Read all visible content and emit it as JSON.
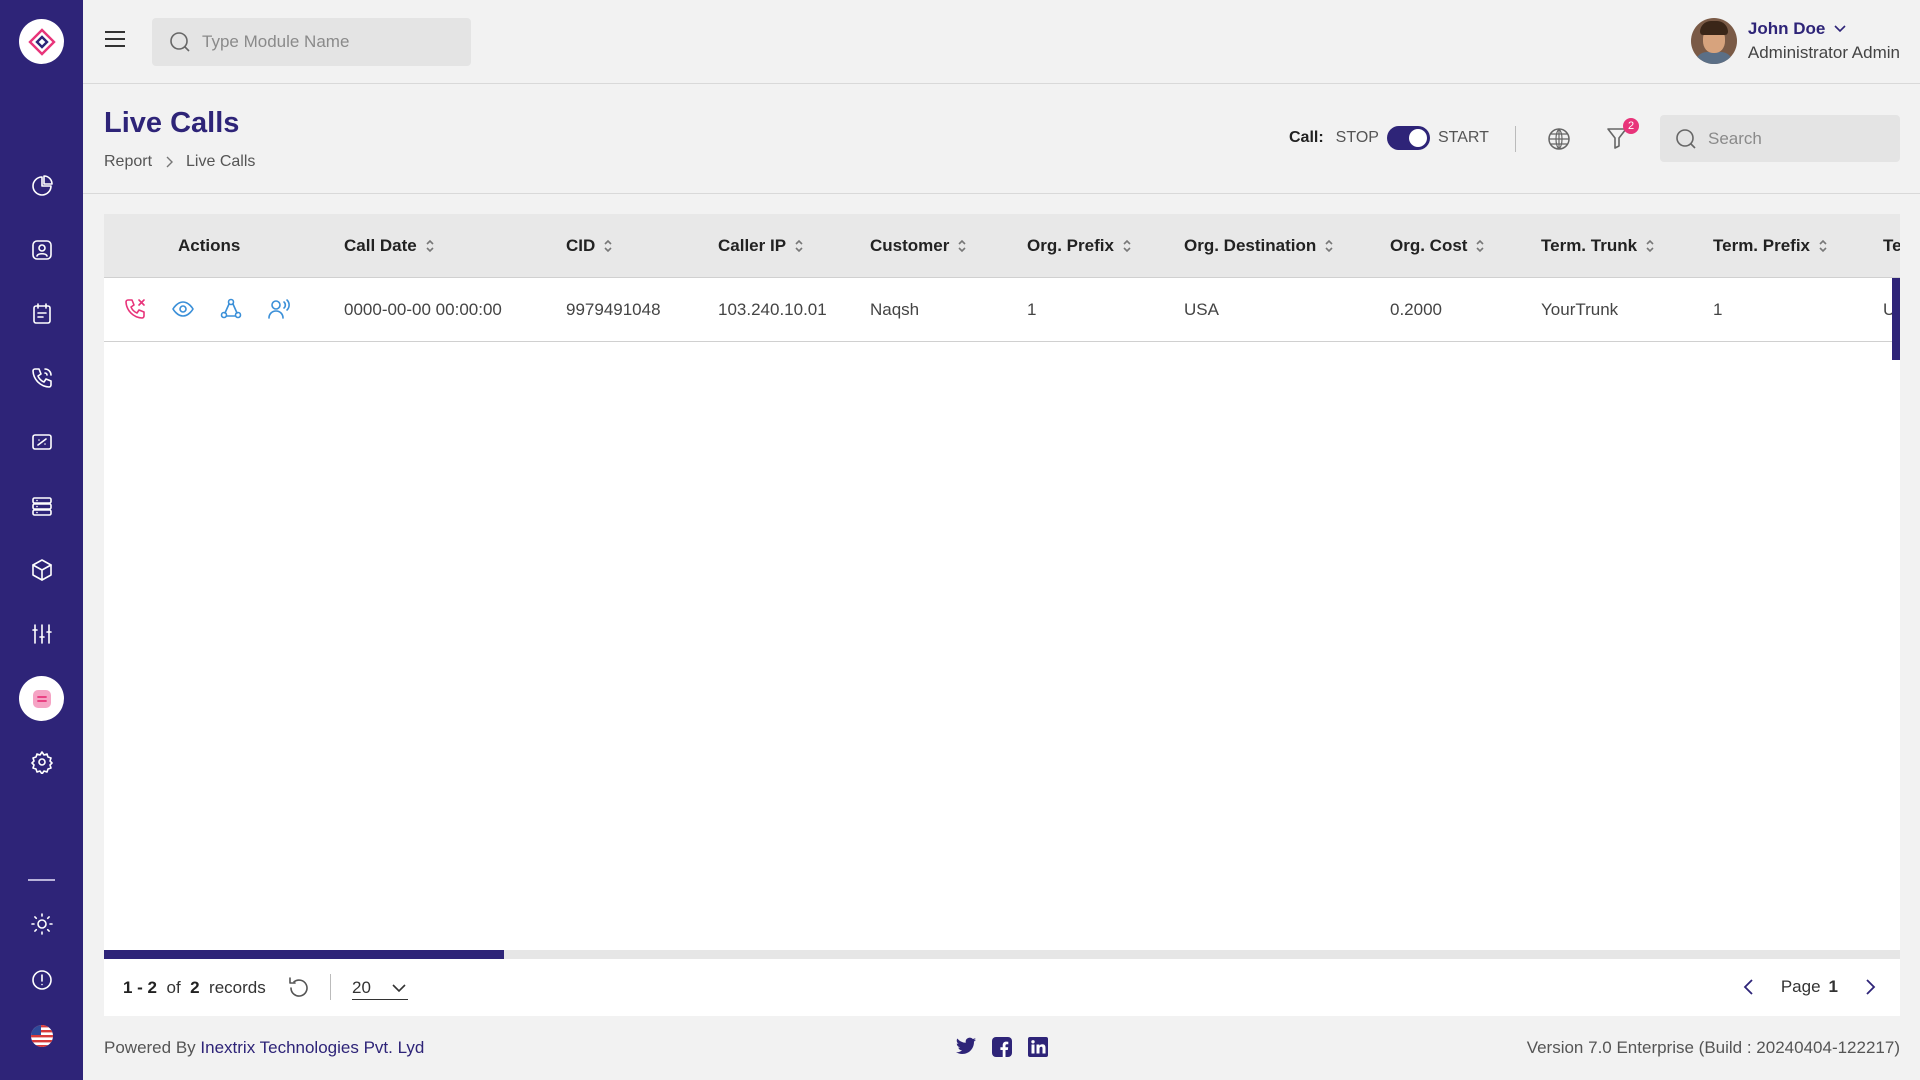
{
  "header": {
    "module_search_placeholder": "Type Module Name",
    "user_name": "John Doe",
    "user_role": "Administrator Admin"
  },
  "page": {
    "title": "Live Calls",
    "breadcrumb": [
      "Report",
      "Live Calls"
    ]
  },
  "toolbar": {
    "call_label": "Call:",
    "stop_label": "STOP",
    "start_label": "START",
    "filter_badge": "2",
    "search_placeholder": "Search"
  },
  "table": {
    "columns": [
      "Actions",
      "Call Date",
      "CID",
      "Caller IP",
      "Customer",
      "Org. Prefix",
      "Org. Destination",
      "Org. Cost",
      "Term. Trunk",
      "Term. Prefix",
      "Te"
    ],
    "rows": [
      {
        "call_date": "0000-00-00 00:00:00",
        "cid": "9979491048",
        "caller_ip": "103.240.10.01",
        "customer": "Naqsh",
        "org_prefix": "1",
        "org_destination": "USA",
        "org_cost": "0.2000",
        "term_trunk": "YourTrunk",
        "term_prefix": "1",
        "truncated": "U"
      }
    ]
  },
  "pagination": {
    "range": "1 - 2",
    "of": "of",
    "total": "2",
    "records": "records",
    "per_page": "20",
    "page_label": "Page",
    "page": "1"
  },
  "footer": {
    "powered_by": "Powered By",
    "company": "Inextrix Technologies Pvt. Lyd",
    "version": "Version 7.0 Enterprise (Build : 20240404-122217)"
  },
  "colors": {
    "primary": "#2e2478",
    "accent_pink": "#e8347a",
    "action_blue": "#3a8fd8"
  }
}
